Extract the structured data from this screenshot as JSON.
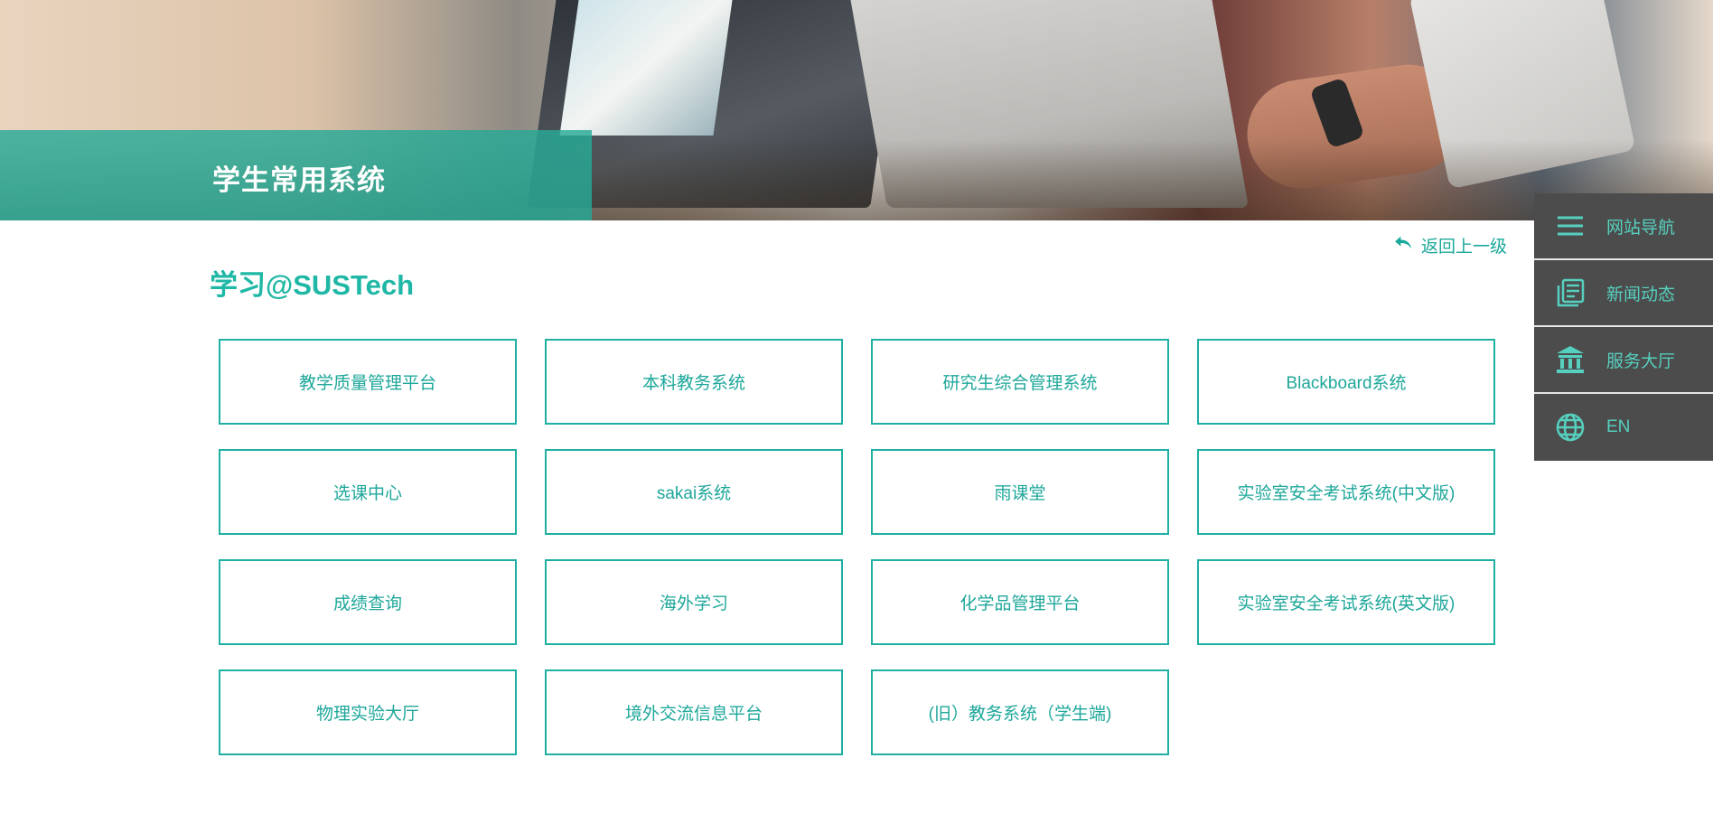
{
  "banner": {
    "title": "学生常用系统"
  },
  "back_link": {
    "label": "返回上一级"
  },
  "section": {
    "title": "学习@SUSTech"
  },
  "systems": [
    "教学质量管理平台",
    "本科教务系统",
    "研究生综合管理系统",
    "Blackboard系统",
    "选课中心",
    "sakai系统",
    "雨课堂",
    "实验室安全考试系统(中文版)",
    "成绩查询",
    "海外学习",
    "化学品管理平台",
    "实验室安全考试系统(英文版)",
    "物理实验大厅",
    "境外交流信息平台",
    "(旧）教务系统（学生端)"
  ],
  "side_nav": {
    "items": [
      {
        "label": "网站导航",
        "icon": "menu-icon"
      },
      {
        "label": "新闻动态",
        "icon": "news-icon"
      },
      {
        "label": "服务大厅",
        "icon": "bank-icon"
      },
      {
        "label": "EN",
        "icon": "globe-icon"
      }
    ]
  },
  "colors": {
    "accent": "#1fb0a3",
    "title_band": "#26aa96",
    "side_nav_bg": "#4c4c4c",
    "side_nav_text": "#56d0bf"
  }
}
